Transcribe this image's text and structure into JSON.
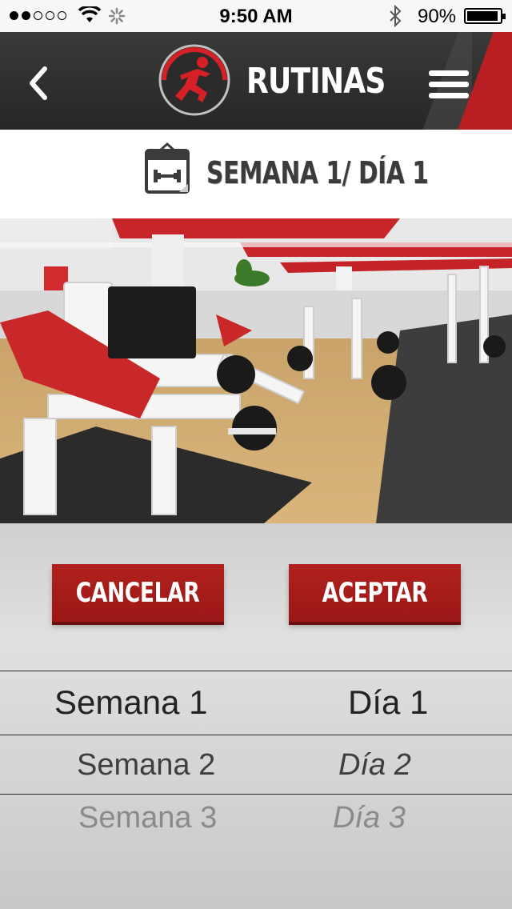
{
  "status_bar": {
    "time": "9:50 AM",
    "battery": "90%",
    "battery_level": 0.9,
    "signal_bars_filled": 2,
    "signal_bars_total": 5
  },
  "nav": {
    "title": "RUTINAS",
    "back_icon": "chevron-left-icon",
    "menu_icon": "hamburger-menu-icon",
    "logo_icon": "running-man-logo",
    "accent_color": "#b81e22"
  },
  "header": {
    "title": "SEMANA 1/ DÍA 1",
    "icon": "calendar-dumbbell-icon"
  },
  "actions": {
    "cancel_label": "CANCELAR",
    "accept_label": "ACEPTAR"
  },
  "picker": {
    "weeks": [
      "Semana 1",
      "Semana 2",
      "Semana 3"
    ],
    "days": [
      "Día 1",
      "Día 2",
      "Día 3"
    ],
    "selected_week": "Semana 1",
    "selected_day": "Día 1"
  }
}
